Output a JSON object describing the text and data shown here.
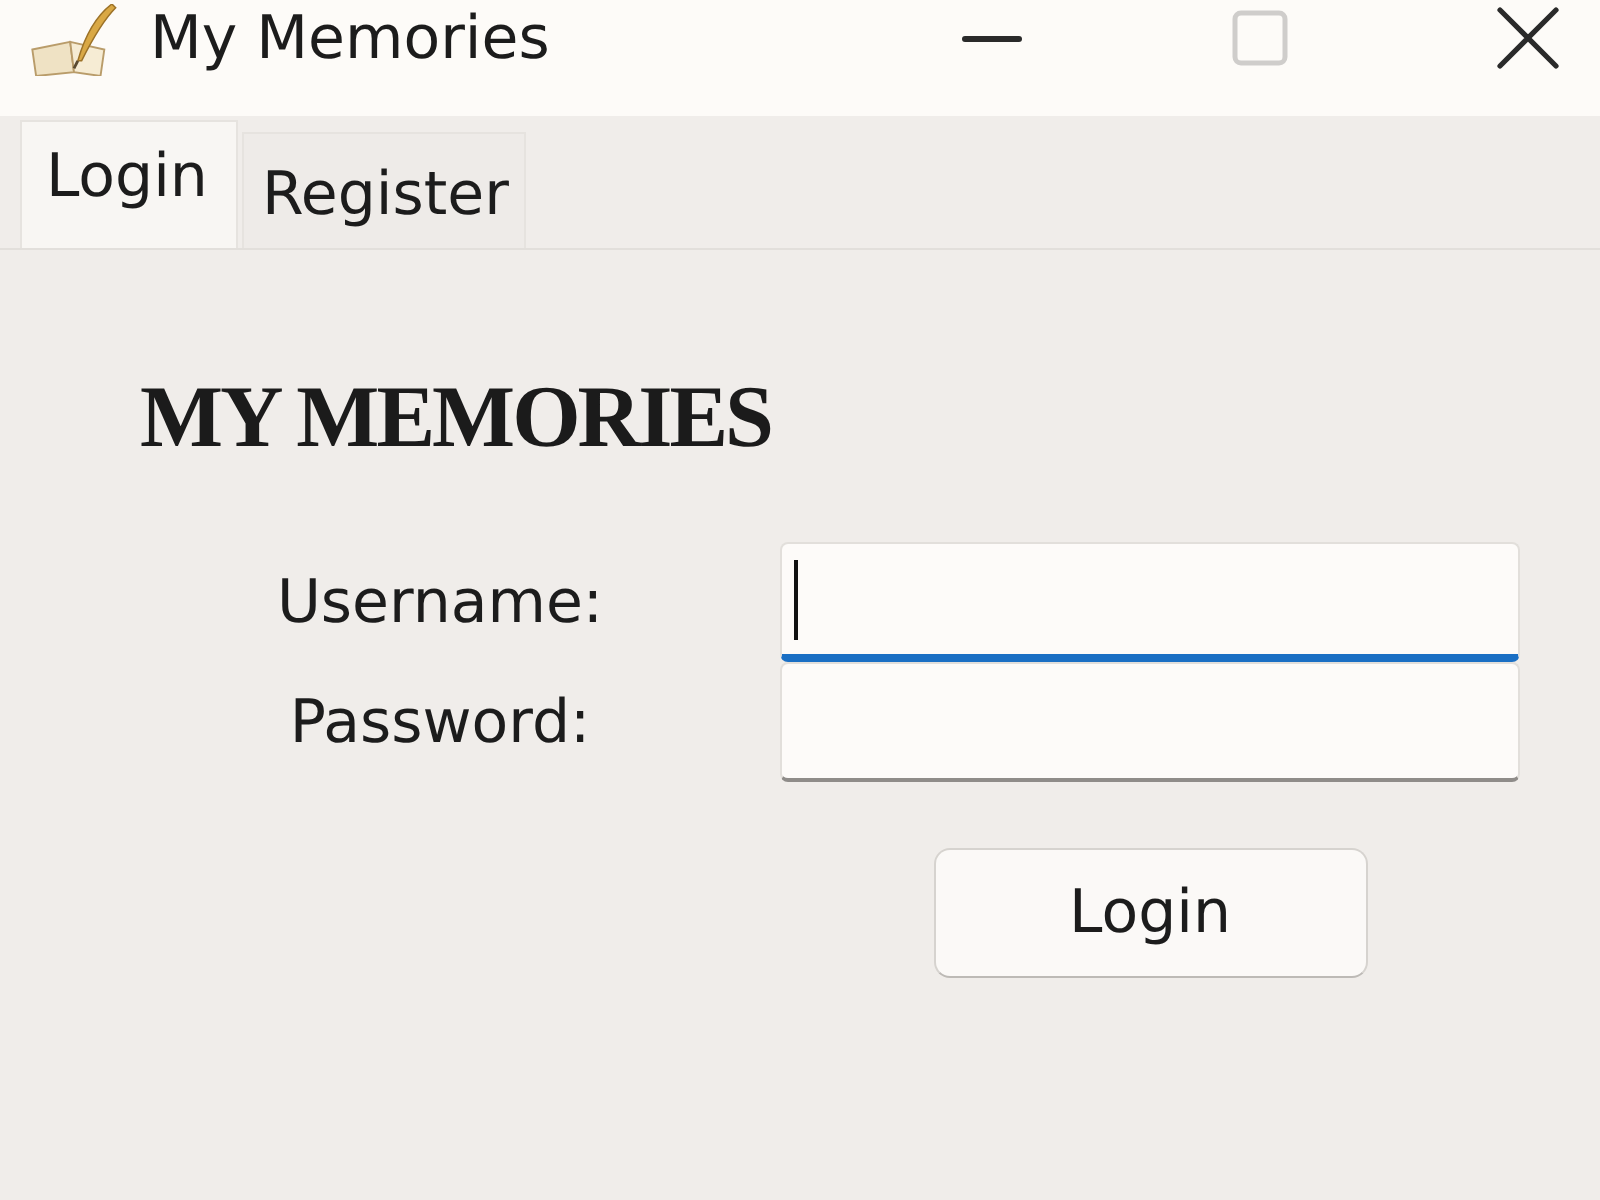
{
  "window": {
    "title": "My Memories",
    "controls": [
      {
        "kind": "minimize",
        "disabled": false
      },
      {
        "kind": "maximize",
        "disabled": true
      },
      {
        "kind": "close",
        "disabled": false
      }
    ]
  },
  "tabs": [
    {
      "label": "Login",
      "selected": true
    },
    {
      "label": "Register",
      "selected": false
    }
  ],
  "heading": "MY MEMORIES",
  "fields": [
    {
      "label": "Username:",
      "focused": true
    },
    {
      "label": "Password:",
      "focused": false
    }
  ],
  "buttons": [
    "Login"
  ]
}
